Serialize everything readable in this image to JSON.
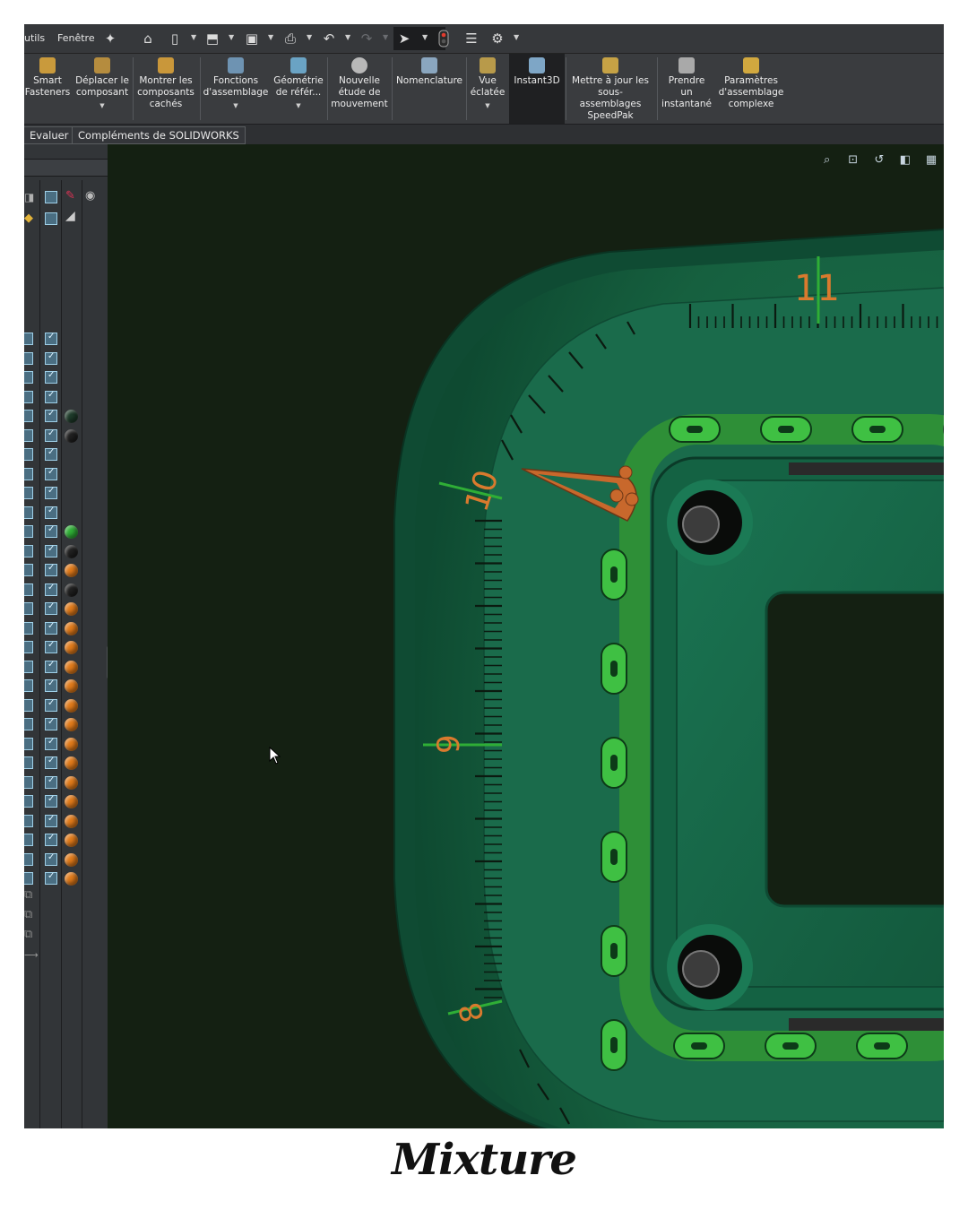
{
  "menubar": {
    "items": [
      "utils",
      "Fenêtre"
    ],
    "pin_icon": "pin-icon",
    "toolbar_icons": [
      "home-icon",
      "new-document-icon",
      "open-icon",
      "save-icon",
      "print-icon",
      "undo-icon",
      "redo-icon",
      "select-icon",
      "traffic-light-icon",
      "options-list-icon",
      "settings-icon"
    ]
  },
  "ribbon": {
    "buttons": [
      {
        "label": "Smart\nFasteners",
        "icon": "smart-fasteners-icon",
        "caret": false
      },
      {
        "label": "Déplacer le\ncomposant",
        "icon": "move-component-icon",
        "caret": true
      },
      {
        "label": "Montrer les\ncomposants\ncachés",
        "icon": "show-hidden-icon",
        "caret": false
      },
      {
        "label": "Fonctions\nd'assemblage",
        "icon": "assembly-features-icon",
        "caret": true
      },
      {
        "label": "Géométrie\nde référ...",
        "icon": "reference-geometry-icon",
        "caret": true
      },
      {
        "label": "Nouvelle\nétude de\nmouvement",
        "icon": "motion-study-icon",
        "caret": false
      },
      {
        "label": "Nomenclature",
        "icon": "bom-icon",
        "caret": false
      },
      {
        "label": "Vue\néclatée",
        "icon": "exploded-view-icon",
        "caret": true
      },
      {
        "label": "Instant3D",
        "icon": "instant3d-icon",
        "caret": false,
        "active": true
      },
      {
        "label": "Mettre à jour les\nsous-assemblages\nSpeedPak",
        "icon": "speedpak-icon",
        "caret": false
      },
      {
        "label": "Prendre\nun\ninstantané",
        "icon": "snapshot-icon",
        "caret": false
      },
      {
        "label": "Paramètres\nd'assemblage\ncomplexe",
        "icon": "large-assembly-icon",
        "caret": false
      }
    ]
  },
  "tabs": [
    "Evaluer",
    "Compléments de SOLIDWORKS"
  ],
  "viewport": {
    "tool_icons": [
      "zoom-to-fit-icon",
      "zoom-area-icon",
      "previous-view-icon",
      "section-view-icon",
      "view-orientation-icon"
    ],
    "dial_numbers": [
      "11",
      "10",
      "9",
      "8"
    ]
  },
  "colors": {
    "viewport_bg": "#142012",
    "model_green": "#1a6e4e",
    "chain_green": "#35b53b",
    "hand_orange": "#c8682c",
    "tick_orange": "#d97a2e"
  },
  "feature_tree": {
    "ball_colors": [
      "#1e3b2a",
      "#202020",
      "",
      "",
      "",
      "",
      "#2fae36",
      "#202020",
      "#e07a1a",
      "#202020",
      "#e07a1a",
      "#e07a1a",
      "#e07a1a",
      "#e07a1a",
      "#e07a1a",
      "#e07a1a",
      "#e07a1a",
      "#e07a1a",
      "#e07a1a",
      "#e07a1a",
      "#e07a1a",
      "#e07a1a",
      "#e07a1a",
      "#e07a1a",
      "#e07a1a"
    ]
  },
  "brand": {
    "logo_text": "Mixture"
  }
}
